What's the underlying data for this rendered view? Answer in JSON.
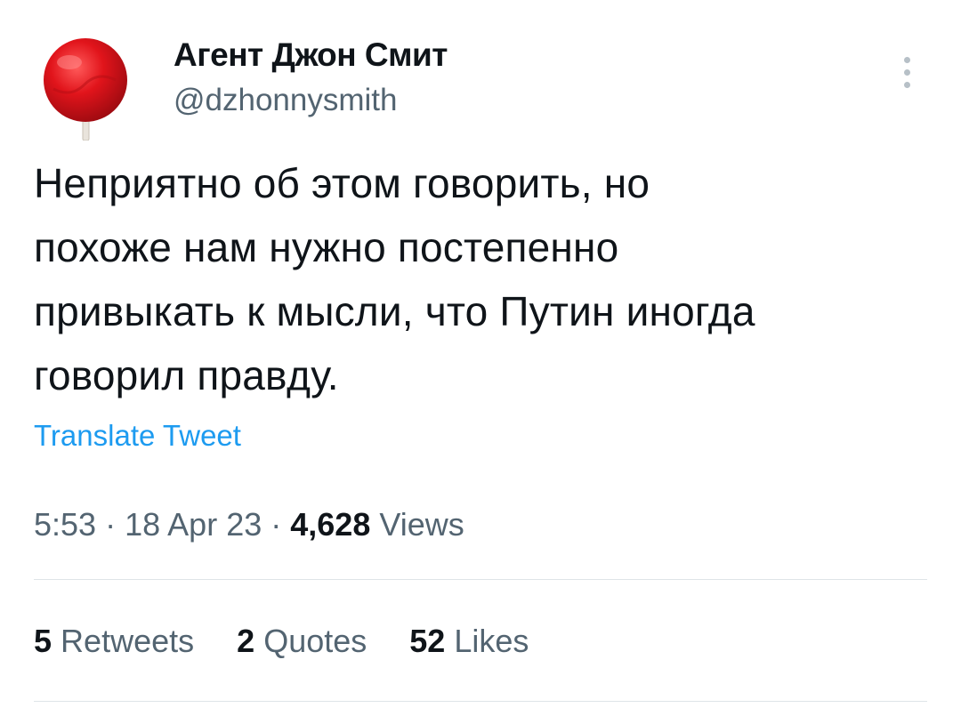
{
  "author": {
    "display_name": "Агент Джон Смит",
    "handle": "@dzhonnysmith",
    "avatar_icon": "red-lollipop-avatar"
  },
  "menu": {
    "icon": "more-vertical-icon"
  },
  "tweet": {
    "text": "Неприятно об этом говорить, но\nпохоже нам нужно постепенно\nпривыкать к мысли, что Путин иногда\nговорил правду."
  },
  "translate": {
    "label": "Translate Tweet"
  },
  "meta": {
    "time": "5:53",
    "separator": "·",
    "date": "18 Apr 23",
    "views_count": "4,628",
    "views_label": "Views"
  },
  "stats": {
    "retweets_count": "5",
    "retweets_label": "Retweets",
    "quotes_count": "2",
    "quotes_label": "Quotes",
    "likes_count": "52",
    "likes_label": "Likes"
  },
  "colors": {
    "text_primary": "#0f1419",
    "text_secondary": "#536471",
    "link": "#1d9bf0",
    "divider": "#dfe4e8",
    "avatar_red": "#e1141b"
  }
}
